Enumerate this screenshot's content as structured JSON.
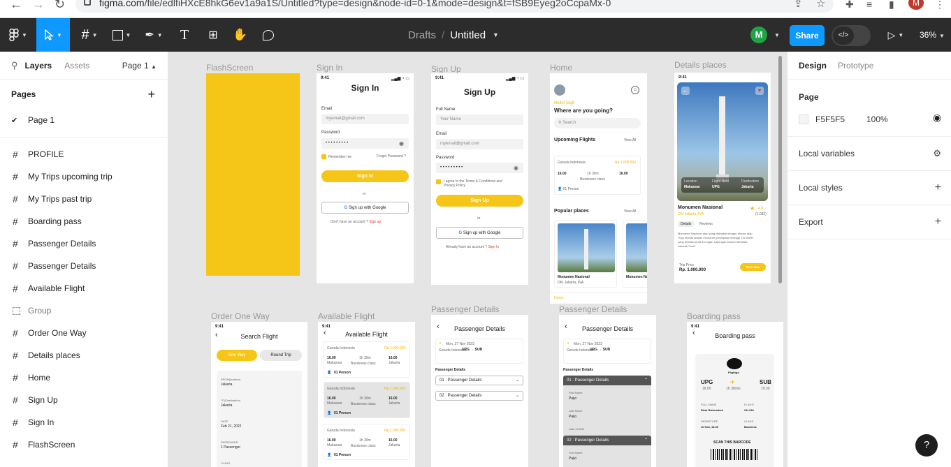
{
  "browser": {
    "url_host": "figma.com",
    "url_path": "/file/edlfiHXcE8hkG6ev1a9a1S/Untitled?type=design&node-id=0-1&mode=design&t=fSB9Eyeg2oCcpaMx-0"
  },
  "toolbar": {
    "breadcrumb_parent": "Drafts",
    "breadcrumb_sep": "/",
    "file_name": "Untitled",
    "avatar_letter": "M",
    "share_label": "Share",
    "zoom": "36%"
  },
  "left": {
    "tabs": [
      "Layers",
      "Assets"
    ],
    "page_selector": "Page 1",
    "pages_header": "Pages",
    "pages": [
      "Page 1"
    ],
    "layers": [
      {
        "name": "PROFILE",
        "kind": "frame"
      },
      {
        "name": "My Trips upcoming trip",
        "kind": "frame"
      },
      {
        "name": "My Trips past trip",
        "kind": "frame"
      },
      {
        "name": "Boarding pass",
        "kind": "frame"
      },
      {
        "name": "Passenger Details",
        "kind": "frame"
      },
      {
        "name": "Passenger Details",
        "kind": "frame"
      },
      {
        "name": "Available Flight",
        "kind": "frame"
      },
      {
        "name": "Group",
        "kind": "group"
      },
      {
        "name": "Order One Way",
        "kind": "frame"
      },
      {
        "name": "Details places",
        "kind": "frame"
      },
      {
        "name": "Home",
        "kind": "frame"
      },
      {
        "name": "Sign Up",
        "kind": "frame"
      },
      {
        "name": "Sign In",
        "kind": "frame"
      },
      {
        "name": "FlashScreen",
        "kind": "frame"
      }
    ]
  },
  "canvas": {
    "frame_labels": {
      "flash": "FlashScreen",
      "signin": "Sign In",
      "signup": "Sign Up",
      "home": "Home",
      "details": "Details places",
      "order": "Order One Way",
      "avail": "Available Flight",
      "pass1": "Passenger Details",
      "pass2": "Passenger Details",
      "boarding": "Boarding pass"
    },
    "time": "9:41",
    "signin": {
      "title": "Sign In",
      "email_label": "Email",
      "email_value": "myemail@gmail.com",
      "password_label": "Password",
      "password_value": "• • • • • • • • •",
      "remember": "Remember me",
      "forgot": "Forget Password ?",
      "button": "Sign In",
      "or": "or",
      "google": "Sign up with Google",
      "footer": "Don't have an account ?",
      "footer_link": "Sign up"
    },
    "signup": {
      "title": "Sign Up",
      "name_label": "Full Name",
      "name_placeholder": "Your Name",
      "email_label": "Email",
      "email_value": "myemail@gmail.com",
      "password_label": "Password",
      "password_value": "• • • • • • • • •",
      "agree": "I agree to the Terms & Conditions and Privacy Policy",
      "button": "Sign Up",
      "or": "or",
      "google": "Sign up with Google",
      "footer": "Already have an account ?",
      "footer_link": "Sign In"
    },
    "home": {
      "hello": "Hello! Sigit",
      "question": "Where are you going?",
      "search": "Search",
      "upcoming": "Upcoming Flights",
      "view_all": "View All",
      "airline": "Garuda Indonesia",
      "price": "Rp.1.000.000",
      "dep_time": "16.00",
      "arr_time": "16.00",
      "duration": "1h 30m",
      "class": "Bussiness class",
      "person": "01 Person",
      "popular": "Popular places",
      "place": "Monumen Nasional",
      "place_loc": "DKI Jakarta, INA",
      "tab_home": "Home"
    },
    "details": {
      "location_label": "Location",
      "location": "Makassar",
      "flight_label": "Flight Next",
      "flight": "UPG",
      "dest_label": "Destination",
      "dest": "Jakarta",
      "title": "Monumen Nasional",
      "loc": "DKI Jakarta, INA",
      "rating": "4.8",
      "reviews": "(1.082)",
      "tab1": "Details",
      "tab2": "Reviews",
      "desc": "Monumen Nasional atau yang disingkat dengan Monas atau Tugu Monas adalah monumen peringatan setinggi 132 meter yang terletak tepat di tengah Lapangan Medan Merdeka, Jakarta Pusat.",
      "trip_price_label": "Trip Price",
      "trip_price": "Rp. 1.000.000",
      "book": "Book Now"
    },
    "order": {
      "title": "Search Flight",
      "one_way": "One Way",
      "round_trip": "Round Trip",
      "from_label": "FROM(location)",
      "from": "Jakarta",
      "to_label": "TO(Destination)",
      "to": "Jakarta",
      "date_label": "DATE",
      "date": "Feb 21, 2022",
      "pass_label": "PASSENGER",
      "pass": "1 Passenger",
      "class_label": "CLASS"
    },
    "avail": {
      "title": "Available Flight",
      "airline": "Garuda Indonesia",
      "price": "Rp.1.000.000",
      "dep": "16.00",
      "arr": "16.00",
      "duration": "1h 30m",
      "class": "Bussiness class",
      "person": "01 Person",
      "from_city": "Makassar",
      "to_city": "Jakarta"
    },
    "pass1": {
      "title": "Passenger Details",
      "date": "Mon, 27 Nov 2023",
      "route": "UPG → SUB",
      "airline": "Garuda Indonesia",
      "section": "Passenger Details",
      "p1": "01 : Passenger Details",
      "p2": "02 : Passenger Details"
    },
    "pass2": {
      "title": "Passenger Details",
      "date": "Mon, 27 Nov 2023",
      "route": "UPG → SUB",
      "airline": "Garuda Indonesia",
      "section": "Passenger Details",
      "p1": "01 : Passenger Details",
      "first_label": "First Name",
      "first": "Paijo",
      "last_label": "Last Name",
      "last": "Paijo",
      "dob_label": "Date of Birth",
      "p2": "02 : Passenger Details",
      "first2_label": "First Name",
      "first2": "Paijo"
    },
    "boarding": {
      "title": "Boarding pass",
      "brand": "Flightgo",
      "from": "UPG",
      "from_time": "18.00",
      "duration": "1h 30min",
      "to": "SUB",
      "to_time": "19.30",
      "name_label": "FULL NAME",
      "name": "Rizal Rahmadani",
      "flight_label": "FLIGHT",
      "flight": "OK.018",
      "dep_label": "DEPARTURE",
      "dep": "10 Nov, 18.00",
      "class_label": "CLASS",
      "class": "Business",
      "scan": "SCAN THIS BARCODE"
    }
  },
  "right": {
    "tabs": [
      "Design",
      "Prototype"
    ],
    "page_header": "Page",
    "bg_color": "F5F5F5",
    "opacity": "100%",
    "sections": [
      "Local variables",
      "Local styles",
      "Export"
    ]
  },
  "help": "?",
  "colors": {
    "accent": "#0d99ff",
    "toolbar": "#2c2c2c",
    "app_yellow": "#f5c518"
  }
}
